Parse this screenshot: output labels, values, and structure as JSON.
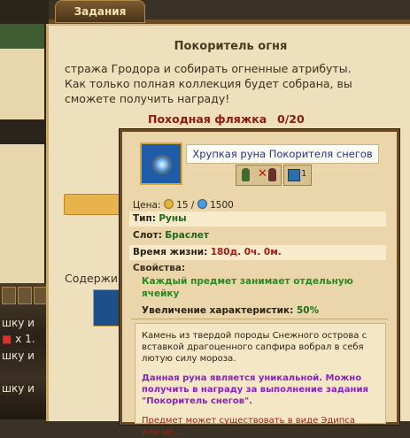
{
  "tab": {
    "label": "Задания"
  },
  "quest": {
    "title": "Покоритель огня",
    "description": "стража Гродора и собирать огненные атрибуты. Как только полная коллекция будет собрана, вы сможете получить награду!",
    "item_name": "Походная фляжка",
    "item_count": "0/20",
    "contents_label": "Содержим"
  },
  "left_panel": {
    "line1": "шку и",
    "line2_prefix": "",
    "line2_count": "x 1.",
    "line3": "шку и",
    "line4": "шку и"
  },
  "tooltip": {
    "item_name": "Хрупкая руна Покорителя снегов",
    "icon": "snow-rune-icon",
    "restriction_icon": "cross-faction-icon",
    "stack_count": "1",
    "price_label": "Цена:",
    "price_gold": "15",
    "price_sep": "/",
    "price_gems": "1500",
    "type_label": "Тип:",
    "type_value": "Руны",
    "slot_label": "Слот:",
    "slot_value": "Браслет",
    "life_label": "Время жизни:",
    "life_value": "180д. 0ч. 0м.",
    "props_label": "Свойства:",
    "props_desc": "Каждый предмет занимает отдельную ячейку",
    "bonus_label": "Увеличение характеристик:",
    "bonus_value": "50%",
    "lore": "Камень из твердой породы Снежного острова с вставкой драгоценного сапфира вобрал в себя лютую силу мороза.",
    "unique": "Данная руна является уникальной. Можно получить в награду за выполнение задания \"Покоритель снегов\".",
    "warning": "Предмет может существовать в виде Эдипса или не..."
  },
  "colors": {
    "accent": "#23328a",
    "positive": "#1e6a1a",
    "negative": "#a31e14",
    "unique": "#8b21c0"
  }
}
